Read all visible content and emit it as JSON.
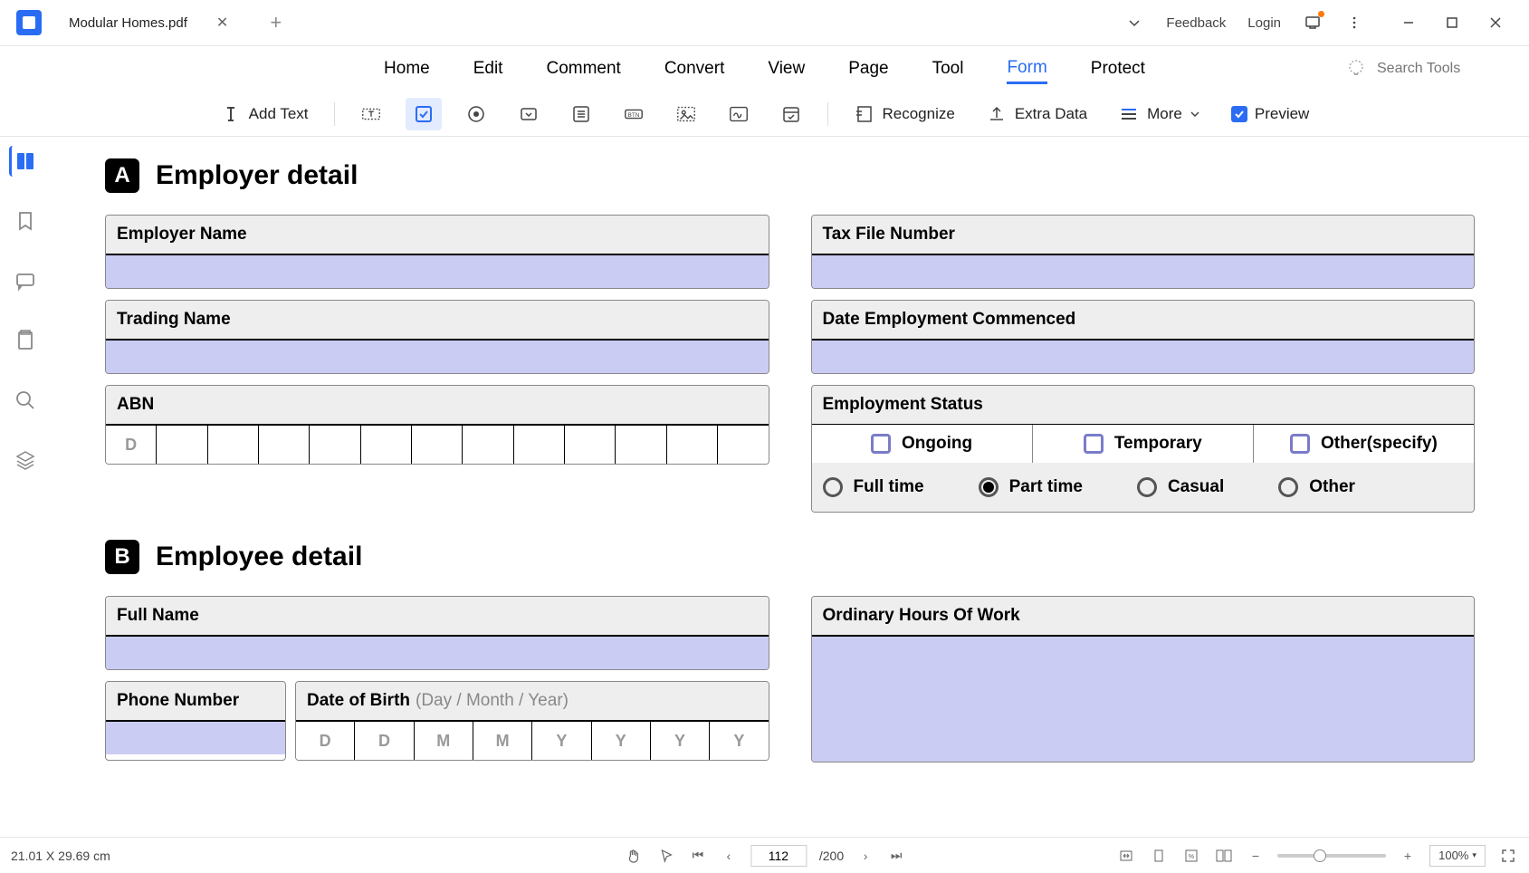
{
  "title_bar": {
    "file_name": "Modular Homes.pdf",
    "feedback": "Feedback",
    "login": "Login"
  },
  "menu": {
    "items": [
      "Home",
      "Edit",
      "Comment",
      "Convert",
      "View",
      "Page",
      "Tool",
      "Form",
      "Protect"
    ],
    "active": "Form",
    "search_placeholder": "Search Tools"
  },
  "toolbar": {
    "add_text": "Add Text",
    "recognize": "Recognize",
    "extra_data": "Extra Data",
    "more": "More",
    "preview": "Preview"
  },
  "form": {
    "section_a_letter": "A",
    "section_a_title": "Employer detail",
    "employer_name": "Employer Name",
    "trading_name": "Trading Name",
    "abn": "ABN",
    "abn_placeholder": "D",
    "tax_file": "Tax File Number",
    "date_commenced": "Date Employment Commenced",
    "emp_status": "Employment Status",
    "status_opts": [
      "Ongoing",
      "Temporary",
      "Other(specify)"
    ],
    "time_opts": [
      "Full time",
      "Part time",
      "Casual",
      "Other"
    ],
    "time_selected": 1,
    "section_b_letter": "B",
    "section_b_title": "Employee detail",
    "full_name": "Full Name",
    "phone": "Phone Number",
    "dob": "Date of Birth",
    "dob_hint": "(Day / Month / Year)",
    "dob_boxes": [
      "D",
      "D",
      "M",
      "M",
      "Y",
      "Y",
      "Y",
      "Y"
    ],
    "hours": "Ordinary Hours Of Work"
  },
  "status": {
    "dimensions": "21.01 X 29.69 cm",
    "page_current": "112",
    "page_total": "/200",
    "zoom": "100%"
  }
}
